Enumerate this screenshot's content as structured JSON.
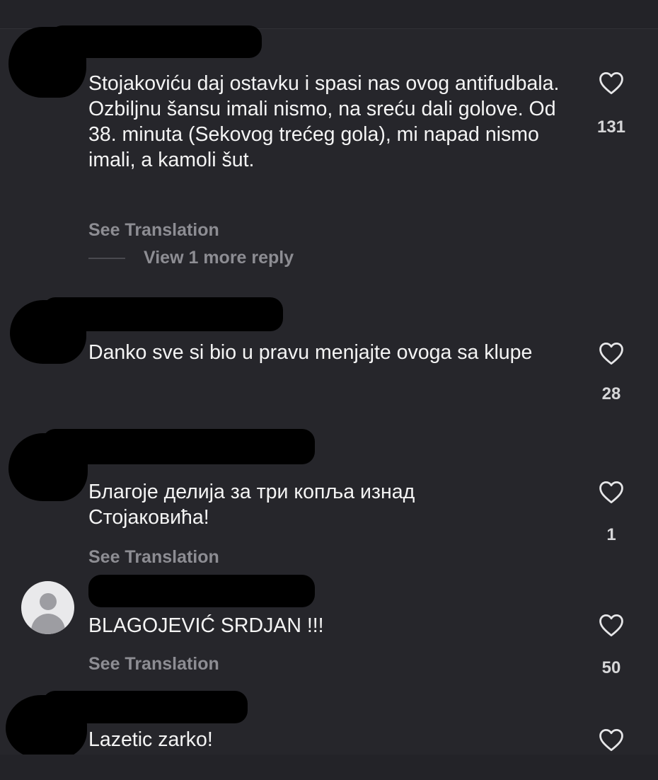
{
  "comments": [
    {
      "text": "Stojakoviću daj ostavku i spasi nas ovog antifudbala. Ozbiljnu šansu imali nismo, na sreću dali golove. Od 38. minuta (Sekovog trećeg gola), mi napad nismo imali, a kamoli šut.",
      "see_translation": "See Translation",
      "view_replies": "View 1 more reply",
      "likes": "131"
    },
    {
      "text": "Danko sve si bio u pravu menjajte ovoga sa klupe",
      "likes": "28"
    },
    {
      "text": "Благоје делија за три копља изнад Стојаковића!",
      "see_translation": "See Translation",
      "likes": "1"
    },
    {
      "text": "BLAGOJEVIĆ SRDJAN !!!",
      "see_translation": "See Translation",
      "likes": "50"
    },
    {
      "text": "Lazetic zarko!"
    }
  ],
  "icons": {
    "like": "heart-outline-icon",
    "avatar": "default-avatar-icon"
  },
  "colors": {
    "background": "#26262b",
    "text": "#f4f4f4",
    "muted": "#8d8d93"
  }
}
